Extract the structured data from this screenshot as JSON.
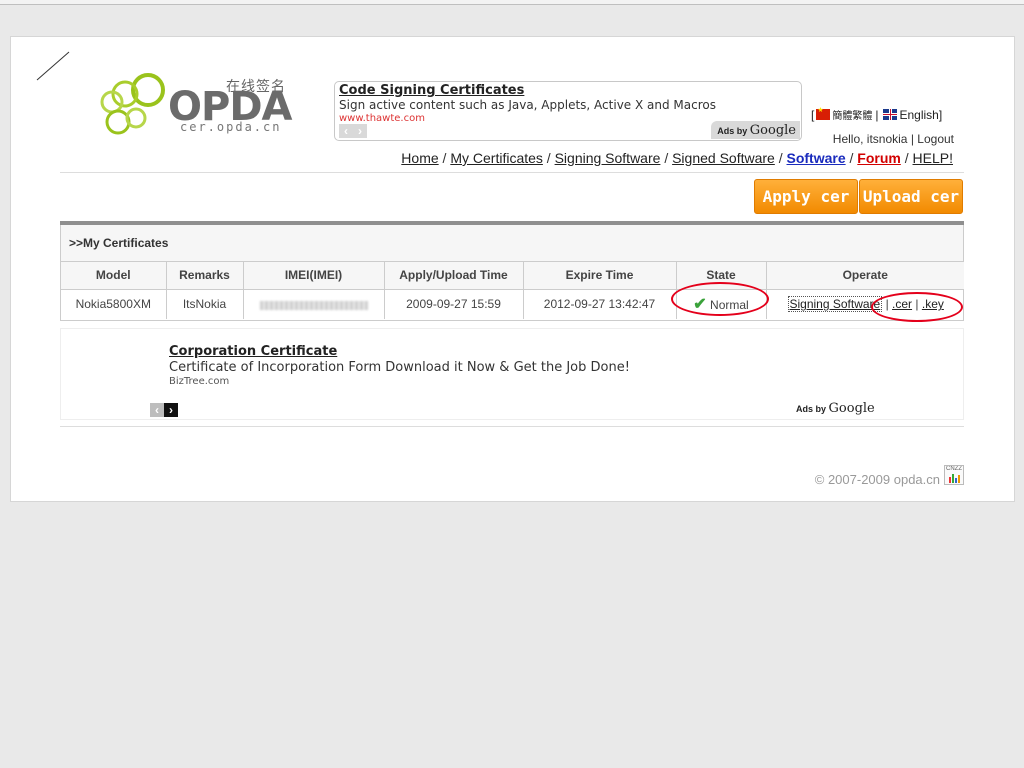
{
  "logo": {
    "chinese": "在线签名",
    "wordmark": "OPDA",
    "domain": "cer.opda.cn"
  },
  "top_ad": {
    "title": "Code Signing Certificates",
    "description": "Sign active content such as Java, Applets, Active X and Macros",
    "url": "www.thawte.com",
    "ads_by": "Ads by",
    "google": "Google"
  },
  "lang": {
    "open": "[",
    "cn_glyphs": "簡體繁體",
    "sep": "|",
    "english": "English]"
  },
  "user": {
    "greeting": "Hello, itsnokia",
    "sep": "|",
    "logout": "Logout"
  },
  "nav": {
    "home": "Home",
    "my_certificates": "My Certificates",
    "signing_software": "Signing Software",
    "signed_software": "Signed Software",
    "software": "Software",
    "forum": "Forum",
    "help": "HELP!",
    "sep": "/"
  },
  "buttons": {
    "apply": "Apply cer",
    "upload": "Upload cer"
  },
  "table": {
    "title": ">>My Certificates",
    "headers": [
      "Model",
      "Remarks",
      "IMEI(IMEI)",
      "Apply/Upload Time",
      "Expire Time",
      "State",
      "Operate"
    ],
    "row": {
      "model": "Nokia5800XM",
      "remarks": "ItsNokia",
      "apply_time": "2009-09-27 15:59",
      "expire_time": "2012-09-27 13:42:47",
      "state": "Normal",
      "op_signing": "Signing Software",
      "op_cer": ".cer",
      "op_key": ".key",
      "op_sep": "|"
    }
  },
  "bottom_ad": {
    "title": "Corporation Certificate",
    "description": "Certificate of Incorporation Form Download it Now & Get the Job Done!",
    "url": "BizTree.com",
    "ads_by": "Ads by",
    "google": "Google"
  },
  "footer": {
    "copyright": "© 2007-2009 opda.cn",
    "badge": "CNZZ"
  },
  "colors": {
    "orange_button": "#f7a21b",
    "forum_red": "#d20000",
    "software_blue": "#1a2bbd",
    "annotation_red": "#e4001b",
    "logo_green": "#9ac31c"
  },
  "icons": [
    "check-icon",
    "china-flag-icon",
    "uk-flag-icon",
    "prev-arrow-icon",
    "next-arrow-icon",
    "cnzz-stats-icon"
  ]
}
